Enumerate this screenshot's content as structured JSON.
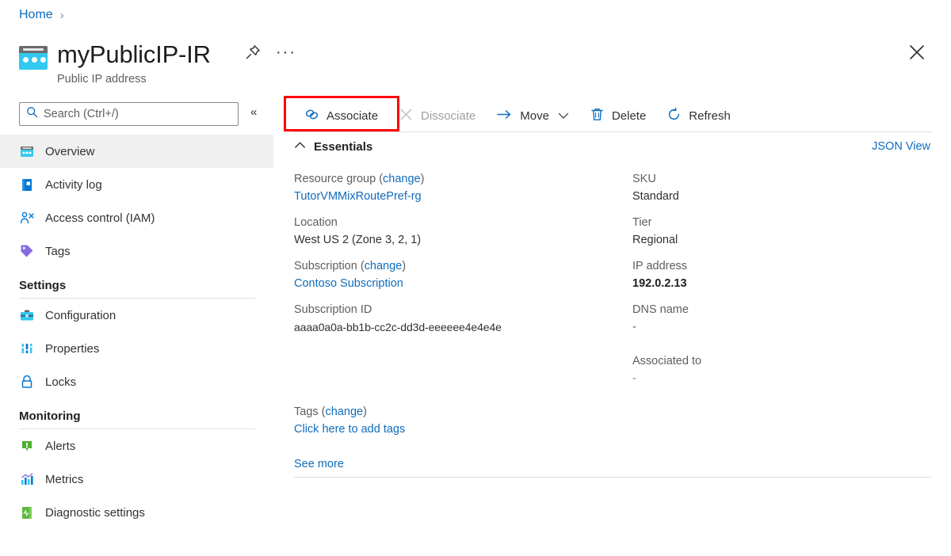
{
  "breadcrumb": {
    "home": "Home",
    "separator": "›"
  },
  "header": {
    "title": "myPublicIP-IR",
    "subtitle": "Public IP address",
    "pin_icon": "pin-icon",
    "more_label": "···",
    "close_icon": "close-icon"
  },
  "search": {
    "placeholder": "Search (Ctrl+/)",
    "value": "",
    "icon": "search-icon",
    "collapse_label": "«"
  },
  "sidebar": {
    "items": [
      {
        "label": "Overview",
        "icon": "overview-icon",
        "selected": true
      },
      {
        "label": "Activity log",
        "icon": "activity-log-icon",
        "selected": false
      },
      {
        "label": "Access control (IAM)",
        "icon": "access-control-icon",
        "selected": false
      },
      {
        "label": "Tags",
        "icon": "tag-icon",
        "selected": false
      }
    ],
    "groups": [
      {
        "title": "Settings",
        "items": [
          {
            "label": "Configuration",
            "icon": "configuration-icon"
          },
          {
            "label": "Properties",
            "icon": "properties-icon"
          },
          {
            "label": "Locks",
            "icon": "lock-icon"
          }
        ]
      },
      {
        "title": "Monitoring",
        "items": [
          {
            "label": "Alerts",
            "icon": "alerts-icon"
          },
          {
            "label": "Metrics",
            "icon": "metrics-icon"
          },
          {
            "label": "Diagnostic settings",
            "icon": "diagnostic-settings-icon"
          }
        ]
      }
    ]
  },
  "toolbar": {
    "associate": {
      "label": "Associate",
      "icon": "link-icon",
      "disabled": false,
      "highlighted": true
    },
    "dissociate": {
      "label": "Dissociate",
      "icon": "x-icon",
      "disabled": true
    },
    "move": {
      "label": "Move",
      "icon": "arrow-right-icon",
      "caret": "∨",
      "disabled": false
    },
    "delete": {
      "label": "Delete",
      "icon": "trash-icon",
      "disabled": false
    },
    "refresh": {
      "label": "Refresh",
      "icon": "refresh-icon",
      "disabled": false
    }
  },
  "essentials": {
    "section_label": "Essentials",
    "collapse_icon": "chevron-up-icon",
    "json_view_label": "JSON View",
    "left": [
      {
        "label": "Resource group",
        "change_label": "change",
        "value": "TutorVMMixRoutePref-rg",
        "value_is_link": true
      },
      {
        "label": "Location",
        "value": "West US 2 (Zone 3, 2, 1)",
        "value_is_link": false
      },
      {
        "label": "Subscription",
        "change_label": "change",
        "value": "Contoso Subscription",
        "value_is_link": true
      },
      {
        "label": "Subscription ID",
        "value": "aaaa0a0a-bb1b-cc2c-dd3d-eeeeee4e4e4e",
        "value_is_link": false
      }
    ],
    "right": [
      {
        "label": "SKU",
        "value": "Standard",
        "value_is_link": false,
        "bold": false
      },
      {
        "label": "Tier",
        "value": "Regional",
        "value_is_link": false,
        "bold": false
      },
      {
        "label": "IP address",
        "value": "192.0.2.13",
        "value_is_link": false,
        "bold": true
      },
      {
        "label": "DNS name",
        "value": "-",
        "value_is_link": false,
        "bold": false
      },
      {
        "label": "Associated to",
        "value": "-",
        "value_is_link": true,
        "bold": false
      }
    ],
    "tags": {
      "label": "Tags",
      "change_label": "change",
      "value": "Click here to add tags"
    },
    "see_more_label": "See more"
  },
  "colors": {
    "link": "#0f6cbd",
    "accent_icon": "#0078d4",
    "highlight_border": "#ff0000",
    "selected_row": "#f0f0f0",
    "muted_text": "#605e5c",
    "disabled_text": "#a19f9d"
  }
}
